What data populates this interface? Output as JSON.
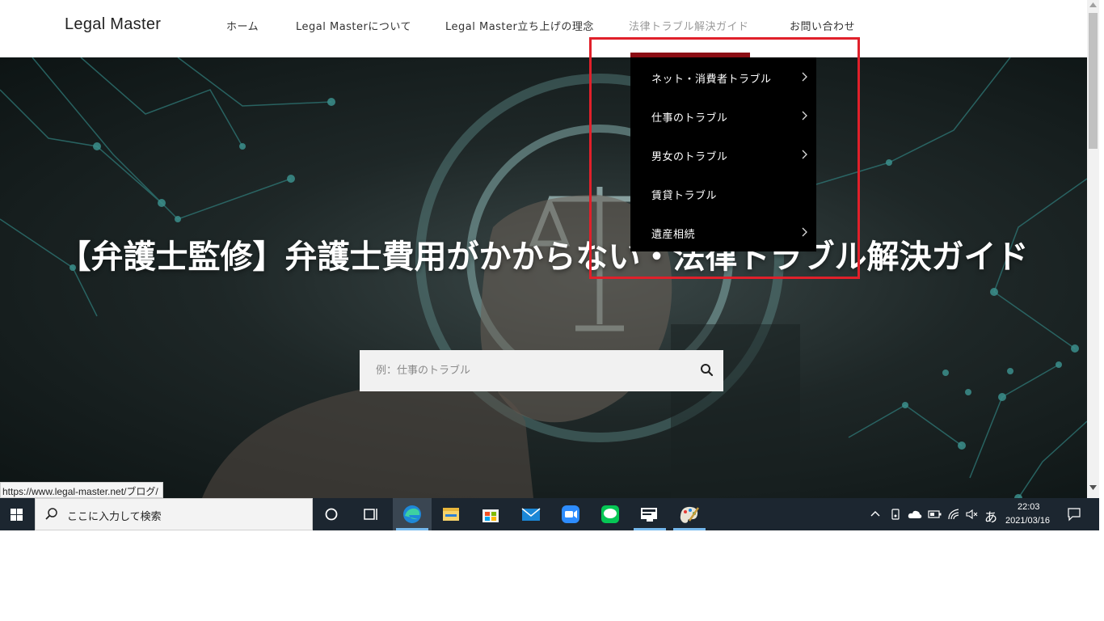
{
  "site": {
    "logo": "Legal Master",
    "nav": [
      {
        "label": "ホーム"
      },
      {
        "label": "Legal Masterについて"
      },
      {
        "label": "Legal Master立ち上げの理念"
      },
      {
        "label": "法律トラブル解決ガイド",
        "active": true
      },
      {
        "label": "お問い合わせ"
      }
    ]
  },
  "dropdown": {
    "items": [
      {
        "label": "ネット・消費者トラブル",
        "has_submenu": true
      },
      {
        "label": "仕事のトラブル",
        "has_submenu": true
      },
      {
        "label": "男女のトラブル",
        "has_submenu": true
      },
      {
        "label": "賃貸トラブル",
        "has_submenu": false
      },
      {
        "label": "遺産相続",
        "has_submenu": true
      }
    ],
    "accent_color": "#8b0d14",
    "highlight_color": "#e0202a"
  },
  "hero": {
    "title": "【弁護士監修】弁護士費用がかからない・法律トラブル解決ガイド",
    "search_placeholder": "例：仕事のトラブル"
  },
  "status_bar": {
    "url": "https://www.legal-master.net/ブログ/"
  },
  "taskbar": {
    "search_placeholder": "ここに入力して検索",
    "apps": [
      "edge-icon",
      "file-explorer-icon",
      "store-icon",
      "mail-icon",
      "zoom-icon",
      "line-icon",
      "remote-desktop-icon",
      "paint-icon"
    ],
    "ime": "あ",
    "time": "22:03",
    "date": "2021/03/16"
  }
}
